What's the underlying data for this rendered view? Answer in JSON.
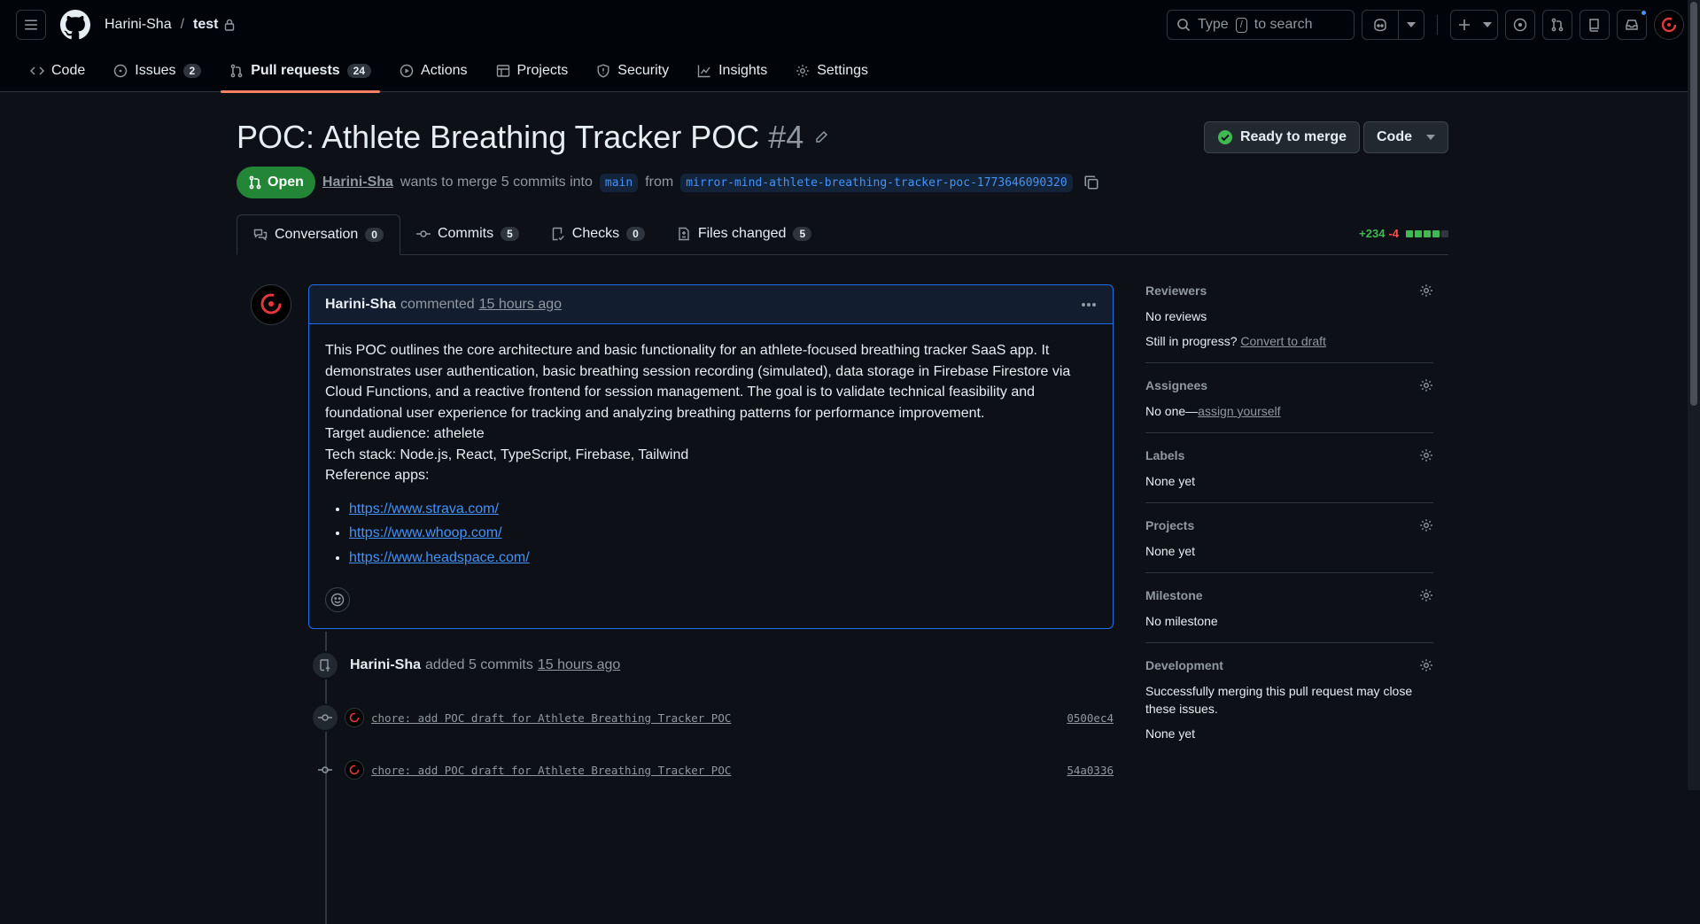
{
  "header": {
    "owner": "Harini-Sha",
    "separator": "/",
    "repo": "test",
    "search_prefix": "Type",
    "search_key": "/",
    "search_suffix": "to search"
  },
  "repo_nav": [
    {
      "label": "Code",
      "icon": "code-icon",
      "count": ""
    },
    {
      "label": "Issues",
      "icon": "issue-opened-icon",
      "count": "2"
    },
    {
      "label": "Pull requests",
      "icon": "git-pull-request-icon",
      "count": "24",
      "active": true
    },
    {
      "label": "Actions",
      "icon": "play-icon",
      "count": ""
    },
    {
      "label": "Projects",
      "icon": "table-icon",
      "count": ""
    },
    {
      "label": "Security",
      "icon": "shield-icon",
      "count": ""
    },
    {
      "label": "Insights",
      "icon": "graph-icon",
      "count": ""
    },
    {
      "label": "Settings",
      "icon": "gear-icon",
      "count": ""
    }
  ],
  "pr": {
    "title": "POC: Athlete Breathing Tracker POC",
    "number": "#4",
    "state": "Open",
    "author": "Harini-Sha",
    "merge_text": "wants to merge 5 commits into",
    "base_branch": "main",
    "from_text": "from",
    "head_branch": "mirror-mind-athlete-breathing-tracker-poc-1773646090320",
    "ready_label": "Ready to merge",
    "code_label": "Code"
  },
  "tabs": [
    {
      "label": "Conversation",
      "count": "0",
      "icon": "comment-discussion-icon",
      "active": true
    },
    {
      "label": "Commits",
      "count": "5",
      "icon": "git-commit-icon"
    },
    {
      "label": "Checks",
      "count": "0",
      "icon": "checklist-icon"
    },
    {
      "label": "Files changed",
      "count": "5",
      "icon": "file-diff-icon"
    }
  ],
  "diffstat": {
    "additions": "+234",
    "deletions": "-4"
  },
  "comment": {
    "author": "Harini-Sha",
    "action": "commented",
    "time": "15 hours ago",
    "paragraph": "This POC outlines the core architecture and basic functionality for an athlete-focused breathing tracker SaaS app. It demonstrates user authentication, basic breathing session recording (simulated), data storage in Firebase Firestore via Cloud Functions, and a reactive frontend for session management. The goal is to validate technical feasibility and foundational user experience for tracking and analyzing breathing patterns for performance improvement.",
    "audience": "Target audience: athelete",
    "stack": "Tech stack: Node.js, React, TypeScript, Firebase, Tailwind",
    "ref_heading": "Reference apps:",
    "links": [
      "https://www.strava.com/",
      "https://www.whoop.com/",
      "https://www.headspace.com/"
    ]
  },
  "event": {
    "author": "Harini-Sha",
    "action": "added 5 commits",
    "time": "15 hours ago"
  },
  "commits": [
    {
      "message": "chore: add POC draft for Athlete Breathing Tracker POC",
      "sha": "0500ec4"
    },
    {
      "message": "chore: add POC draft for Athlete Breathing Tracker POC",
      "sha": "54a0336"
    }
  ],
  "sidebar": {
    "reviewers": {
      "title": "Reviewers",
      "value": "No reviews",
      "progress_text": "Still in progress?",
      "draft_link": "Convert to draft"
    },
    "assignees": {
      "title": "Assignees",
      "value": "No one—",
      "link": "assign yourself"
    },
    "labels": {
      "title": "Labels",
      "value": "None yet"
    },
    "projects": {
      "title": "Projects",
      "value": "None yet"
    },
    "milestone": {
      "title": "Milestone",
      "value": "No milestone"
    },
    "development": {
      "title": "Development",
      "desc": "Successfully merging this pull request may close these issues.",
      "value": "None yet"
    }
  },
  "colors": {
    "accent": "#f78166",
    "open_green": "#238636",
    "link_blue": "#4493f8",
    "bg": "#0d1117"
  }
}
